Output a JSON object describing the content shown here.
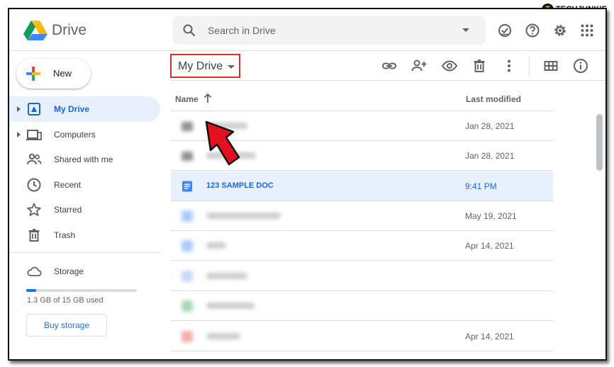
{
  "watermark": "TECHJUNKIE",
  "header": {
    "app_name": "Drive",
    "search_placeholder": "Search in Drive"
  },
  "sidebar": {
    "new_label": "New",
    "items": [
      {
        "label": "My Drive",
        "icon": "my-drive-icon",
        "active": true
      },
      {
        "label": "Computers",
        "icon": "computer-icon",
        "active": false
      },
      {
        "label": "Shared with me",
        "icon": "people-icon",
        "active": false
      },
      {
        "label": "Recent",
        "icon": "clock-icon",
        "active": false
      },
      {
        "label": "Starred",
        "icon": "star-icon",
        "active": false
      },
      {
        "label": "Trash",
        "icon": "trash-icon",
        "active": false
      }
    ],
    "storage": {
      "label": "Storage",
      "used_text": "1.3 GB of 15 GB used",
      "used_fraction": 0.087,
      "buy_label": "Buy storage"
    }
  },
  "toolbar": {
    "location_label": "My Drive"
  },
  "file_list": {
    "col_name": "Name",
    "col_modified": "Last modified",
    "rows": [
      {
        "name": "",
        "modified": "Jan 28, 2021",
        "type": "folder",
        "blurred": true
      },
      {
        "name": "",
        "modified": "Jan 28, 2021",
        "type": "folder",
        "blurred": true
      },
      {
        "name": "123 SAMPLE DOC",
        "modified": "9:41 PM",
        "type": "doc",
        "blurred": false,
        "selected": true
      },
      {
        "name": "",
        "modified": "May 19, 2021",
        "type": "doc",
        "blurred": true
      },
      {
        "name": "",
        "modified": "Apr 14, 2021",
        "type": "doc",
        "blurred": true
      },
      {
        "name": "",
        "modified": "",
        "type": "doc",
        "blurred": true
      },
      {
        "name": "",
        "modified": "",
        "type": "sheet",
        "blurred": true
      },
      {
        "name": "",
        "modified": "Apr 14, 2021",
        "type": "pdf",
        "blurred": true
      }
    ]
  },
  "colors": {
    "accent": "#1a73e8",
    "selected_bg": "#e8f0fe",
    "highlight_box": "#d93025",
    "arrow": "#e2111d"
  }
}
